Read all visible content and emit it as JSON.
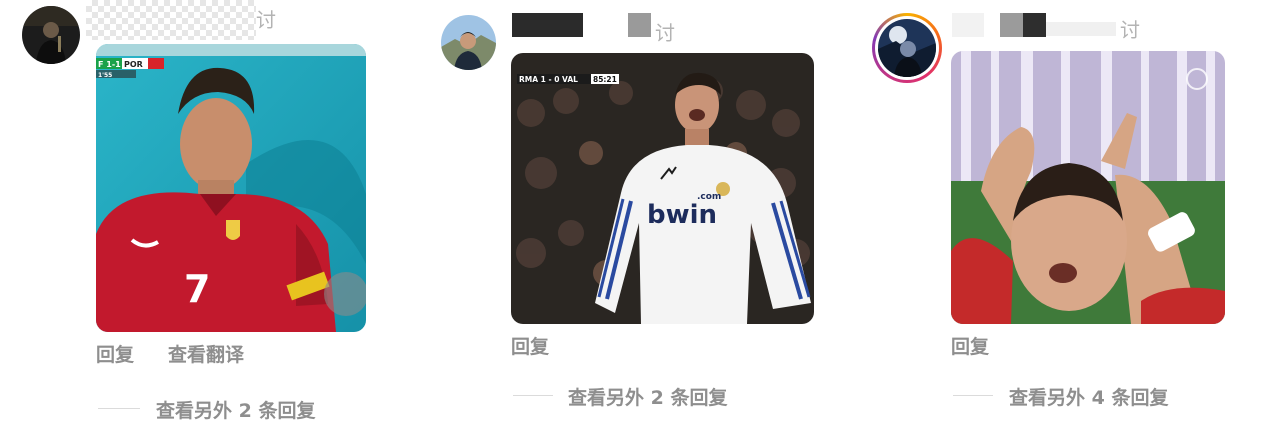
{
  "comments": [
    {
      "time_fragment": "讨",
      "media": {
        "scorebug_left": "F 1-1",
        "scorebug_team": "POR",
        "scorebug_sub": "1'55",
        "jersey_number": "7"
      },
      "actions": {
        "reply": "回复",
        "translate": "查看翻译"
      },
      "view_more": "查看另外 2 条回复"
    },
    {
      "time_fragment": "讨",
      "media": {
        "scorebug": "RMA 1 - 0 VAL",
        "clock": "85:21",
        "shirt_sponsor": "bwin",
        "shirt_sponsor_sup": ".com"
      },
      "actions": {
        "reply": "回复"
      },
      "view_more": "查看另外 2 条回复"
    },
    {
      "time_fragment": "讨",
      "actions": {
        "reply": "回复"
      },
      "view_more": "查看另外 4 条回复"
    }
  ],
  "colors": {
    "meta_text": "#8e8e8e",
    "divider": "#dbdbdb",
    "story_ring": [
      "#f9b200",
      "#e1306c",
      "#833ab4"
    ]
  }
}
